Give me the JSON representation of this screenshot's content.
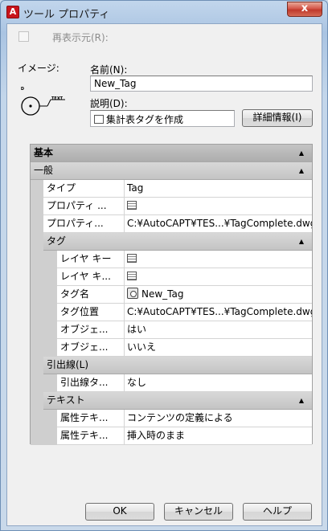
{
  "window": {
    "title": "ツール プロパティ",
    "close_glyph": "x"
  },
  "regen": {
    "label": "再表示元(R):"
  },
  "image": {
    "label": "イメージ:",
    "preview_text": "TEXT",
    "preview_sub": "D"
  },
  "name": {
    "label": "名前(N):",
    "value": "New_Tag"
  },
  "description": {
    "label": "説明(D):",
    "value": "集計表タグを作成",
    "details_button": "詳細情報(I)"
  },
  "grid": {
    "root": {
      "label": "基本"
    },
    "general": {
      "label": "一般",
      "rows": [
        {
          "name": "タイプ",
          "value": "Tag"
        },
        {
          "name": "プロパティ ...",
          "value": ""
        },
        {
          "name": "プロパティ...",
          "value": "C:¥AutoCAPT¥TES...¥TagComplete.dwg"
        }
      ]
    },
    "tag": {
      "label": "タグ",
      "rows": [
        {
          "name": "レイヤ キー",
          "value": ""
        },
        {
          "name": "レイヤ キ...",
          "value": ""
        },
        {
          "name": "タグ名",
          "value": "New_Tag"
        },
        {
          "name": "タグ位置",
          "value": "C:¥AutoCAPT¥TES...¥TagComplete.dwg"
        },
        {
          "name": "オブジェ...",
          "value": "はい"
        },
        {
          "name": "オブジェ...",
          "value": "いいえ"
        }
      ]
    },
    "leader": {
      "label": "引出線(L)",
      "rows": [
        {
          "name": "引出線タ...",
          "value": "なし"
        }
      ]
    },
    "text": {
      "label": "テキスト",
      "rows": [
        {
          "name": "属性テキ...",
          "value": "コンテンツの定義による"
        },
        {
          "name": "属性テキ...",
          "value": "挿入時のまま"
        }
      ]
    },
    "collapse_glyph": "▲"
  },
  "buttons": {
    "ok": "OK",
    "cancel": "キャンセル",
    "help": "ヘルプ"
  }
}
